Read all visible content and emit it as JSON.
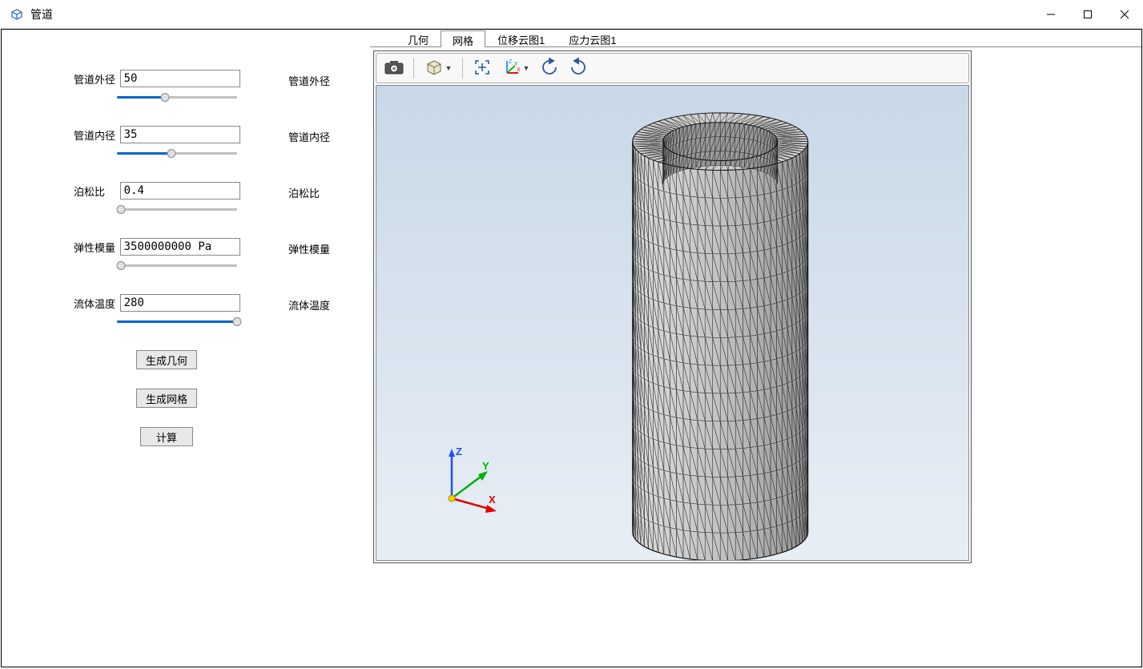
{
  "window": {
    "title": "管道"
  },
  "params": {
    "outer_diameter": {
      "label": "管道外径",
      "value": "50",
      "right_label": "管道外径",
      "fill": 40
    },
    "inner_diameter": {
      "label": "管道内径",
      "value": "35",
      "right_label": "管道内径",
      "fill": 45
    },
    "poisson": {
      "label": "泊松比",
      "value": "0.4",
      "right_label": "泊松比",
      "fill": 3
    },
    "elastic": {
      "label": "弹性模量",
      "value": "3500000000 Pa",
      "right_label": "弹性模量",
      "fill": 3
    },
    "fluid_temp": {
      "label": "流体温度",
      "value": "280",
      "right_label": "流体温度",
      "fill": 100
    }
  },
  "buttons": {
    "gen_geometry": "生成几何",
    "gen_mesh": "生成网格",
    "compute": "计算"
  },
  "tabs": {
    "geometry": "几何",
    "mesh": "网格",
    "disp_cloud": "位移云图1",
    "stress_cloud": "应力云图1",
    "active": "mesh"
  },
  "triad": {
    "x": "X",
    "y": "Y",
    "z": "Z"
  }
}
